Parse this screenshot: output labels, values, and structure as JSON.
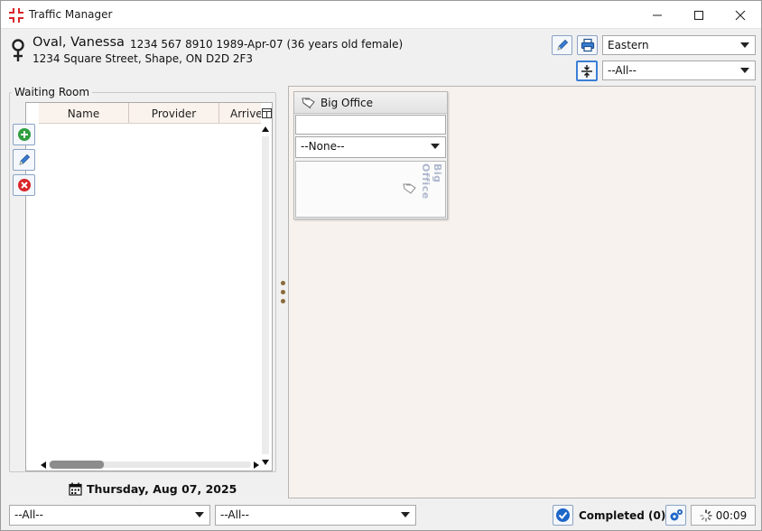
{
  "window": {
    "title": "Traffic Manager",
    "controls": {
      "minimize": "minimize-icon",
      "maximize": "maximize-icon",
      "close": "close-icon"
    }
  },
  "patient": {
    "name": "Oval, Vanessa",
    "details": "1234 567 8910  1989-Apr-07 (36 years old female)",
    "address": "1234 Square Street, Shape, ON D2D 2F3",
    "sex_icon": "female-icon"
  },
  "header": {
    "region_select": "Eastern",
    "filter_select": "--All--",
    "edit_icon": "pencil-icon",
    "print_icon": "printer-icon",
    "collapse_icon": "expand-collapse-icon"
  },
  "waiting_room": {
    "title": "Waiting Room",
    "columns": [
      "Name",
      "Provider",
      "Arrive"
    ],
    "rows": []
  },
  "schedule_date": "Thursday, Aug 07, 2025",
  "room": {
    "name": "Big Office",
    "select": "--None--",
    "vertical_label": "Big Office"
  },
  "footer": {
    "left_select": "--All--",
    "middle_select": "--All--",
    "completed": "Completed (0)",
    "timer": "00:09"
  },
  "colors": {
    "accent": "#3a7fd6",
    "add": "#2e9e3e",
    "delete": "#d9262a",
    "schedule_bg": "#f7f2ee"
  }
}
